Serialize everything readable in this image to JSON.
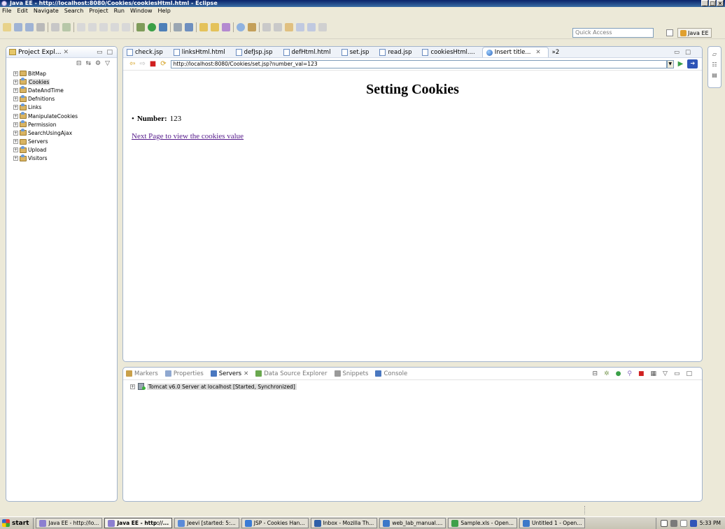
{
  "window": {
    "title": "Java EE - http://localhost:8080/Cookies/cookiesHtml.html - Eclipse"
  },
  "menu": [
    "File",
    "Edit",
    "Navigate",
    "Search",
    "Project",
    "Run",
    "Window",
    "Help"
  ],
  "toolbar": {
    "quick_access_placeholder": "Quick Access",
    "perspective": "Java EE"
  },
  "project_explorer": {
    "title": "Project Expl...",
    "projects": [
      {
        "name": "BitMap",
        "type": "folder"
      },
      {
        "name": "Cookies",
        "type": "web",
        "selected": true
      },
      {
        "name": "DateAndTime",
        "type": "web"
      },
      {
        "name": "Defnitions",
        "type": "web"
      },
      {
        "name": "Links",
        "type": "web"
      },
      {
        "name": "ManipulateCookies",
        "type": "web"
      },
      {
        "name": "Permission",
        "type": "web"
      },
      {
        "name": "SearchUsingAjax",
        "type": "web"
      },
      {
        "name": "Servers",
        "type": "folder"
      },
      {
        "name": "Upload",
        "type": "web"
      },
      {
        "name": "Visitors",
        "type": "web"
      }
    ]
  },
  "editor": {
    "tabs": [
      {
        "label": "check.jsp",
        "icon": "file-icon"
      },
      {
        "label": "linksHtml.html",
        "icon": "file-icon"
      },
      {
        "label": "defJsp.jsp",
        "icon": "file-icon"
      },
      {
        "label": "defHtml.html",
        "icon": "file-icon"
      },
      {
        "label": "set.jsp",
        "icon": "file-icon"
      },
      {
        "label": "read.jsp",
        "icon": "file-icon"
      },
      {
        "label": "cookiesHtml....",
        "icon": "file-icon"
      },
      {
        "label": "Insert title...",
        "icon": "globe-icon",
        "active": true
      }
    ],
    "overflow_label": "»2",
    "close_glyph": "✕",
    "url": "http://localhost:8080/Cookies/set.jsp?number_val=123",
    "page": {
      "heading": "Setting Cookies",
      "item_label": "Number:",
      "item_value": "123",
      "link_text": "Next Page to view the cookies value"
    }
  },
  "bottom_panel": {
    "tabs": [
      {
        "label": "Markers",
        "color": "#c9a04a"
      },
      {
        "label": "Properties",
        "color": "#8fa8d0"
      },
      {
        "label": "Servers",
        "color": "#4a78c0",
        "active": true
      },
      {
        "label": "Data Source Explorer",
        "color": "#6aa84f"
      },
      {
        "label": "Snippets",
        "color": "#9a9a9a"
      },
      {
        "label": "Console",
        "color": "#4a78c0"
      }
    ],
    "server": "Tomcat v6.0 Server at localhost  [Started, Synchronized]"
  },
  "taskbar": {
    "start_label": "start",
    "tasks": [
      {
        "label": "Java EE - http://lo...",
        "color": "#8c7fd0"
      },
      {
        "label": "Java EE - http://...",
        "color": "#8c7fd0",
        "active": true
      },
      {
        "label": "Jeevi [started: 5:...",
        "color": "#5a8ad8"
      },
      {
        "label": "JSP - Cookies Han...",
        "color": "#3a7bd5"
      },
      {
        "label": "Inbox - Mozilla Th...",
        "color": "#2f5fa8"
      },
      {
        "label": "web_lab_manual....",
        "color": "#3c78c8"
      },
      {
        "label": "Sample.xls - Open...",
        "color": "#3ea04a"
      },
      {
        "label": "Untitled 1 - Open...",
        "color": "#3c78c8"
      }
    ],
    "clock": "5:33 PM"
  }
}
